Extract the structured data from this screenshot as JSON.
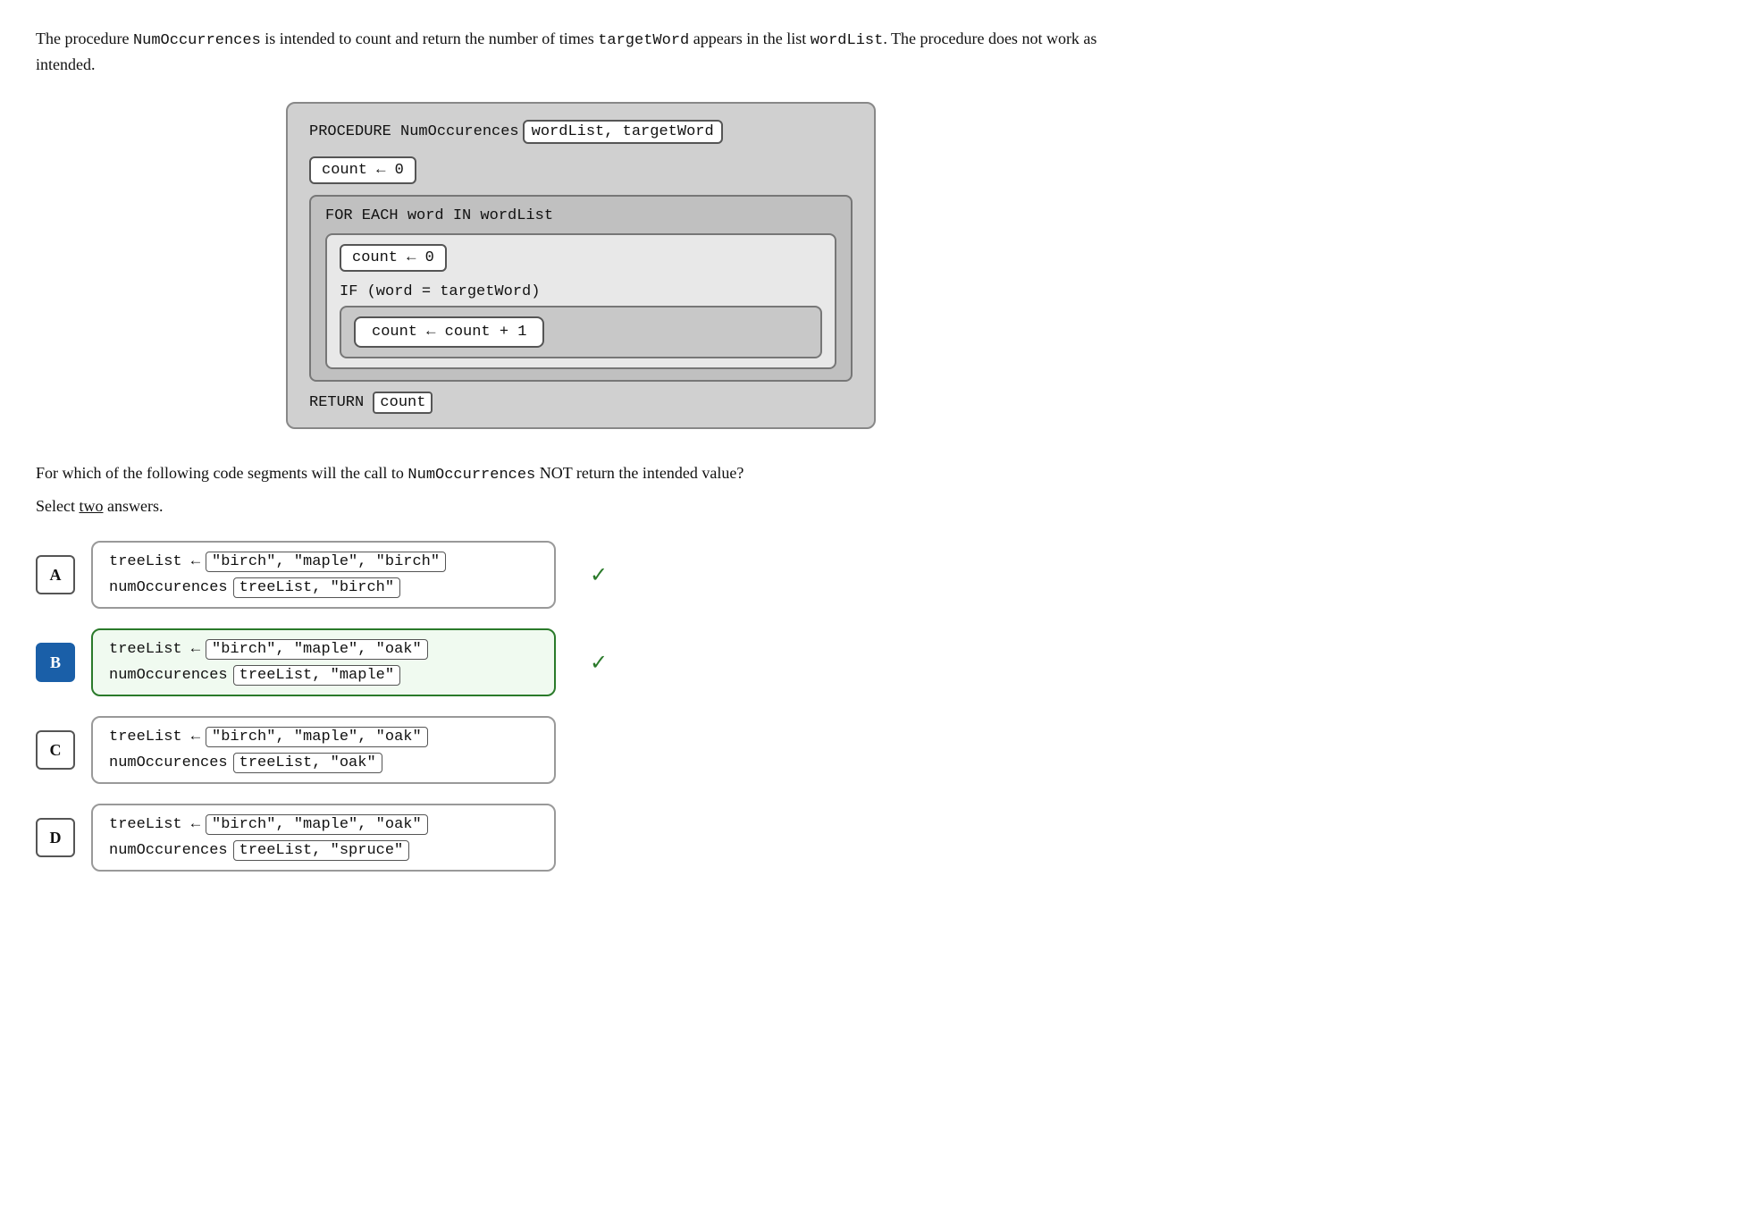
{
  "intro": {
    "text1": "The procedure ",
    "proc_name": "NumOccurrences",
    "text2": " is intended to count and return the number of times ",
    "target_word": "targetWord",
    "text3": " appears in the list ",
    "word_list": "wordList",
    "text4": ". The procedure does not work as intended."
  },
  "procedure": {
    "title": "PROCEDURE NumOccurences",
    "params": "wordList, targetWord",
    "line1": "count ← 0",
    "for_label": "FOR EACH word IN wordList",
    "line2": "count ← 0",
    "if_label": "IF (word = targetWord)",
    "line3": "count ← count + 1",
    "return": "RETURN",
    "return_var": "count"
  },
  "question": {
    "text": "For which of the following code segments will the call to ",
    "mono_text": "NumOccurrences",
    "text2": " NOT return the intended value?",
    "select": "Select ",
    "select_underline": "two",
    "select_end": " answers."
  },
  "answers": [
    {
      "id": "A",
      "selected": false,
      "highlighted": false,
      "line1_pre": "treeList ←",
      "line1_values": "\"birch\",  \"maple\",  \"birch\"",
      "line2_pre": "numOccurences",
      "line2_values": "treeList,  \"birch\"",
      "check": true
    },
    {
      "id": "B",
      "selected": true,
      "highlighted": true,
      "line1_pre": "treeList ←",
      "line1_values": "\"birch\",  \"maple\",  \"oak\"",
      "line2_pre": "numOccurences",
      "line2_values": "treeList,  \"maple\"",
      "check": true
    },
    {
      "id": "C",
      "selected": false,
      "highlighted": false,
      "line1_pre": "treeList ←",
      "line1_values": "\"birch\",  \"maple\",  \"oak\"",
      "line2_pre": "numOccurences",
      "line2_values": "treeList,  \"oak\"",
      "check": false
    },
    {
      "id": "D",
      "selected": false,
      "highlighted": false,
      "line1_pre": "treeList ←",
      "line1_values": "\"birch\",  \"maple\",  \"oak\"",
      "line2_pre": "numOccurences",
      "line2_values": "treeList,  \"spruce\"",
      "check": false
    }
  ],
  "colors": {
    "selected_bg": "#1a5fa8",
    "check_color": "#2a7a2a",
    "highlight_border": "#2a7a2a",
    "highlight_bg": "#f0faf0"
  }
}
